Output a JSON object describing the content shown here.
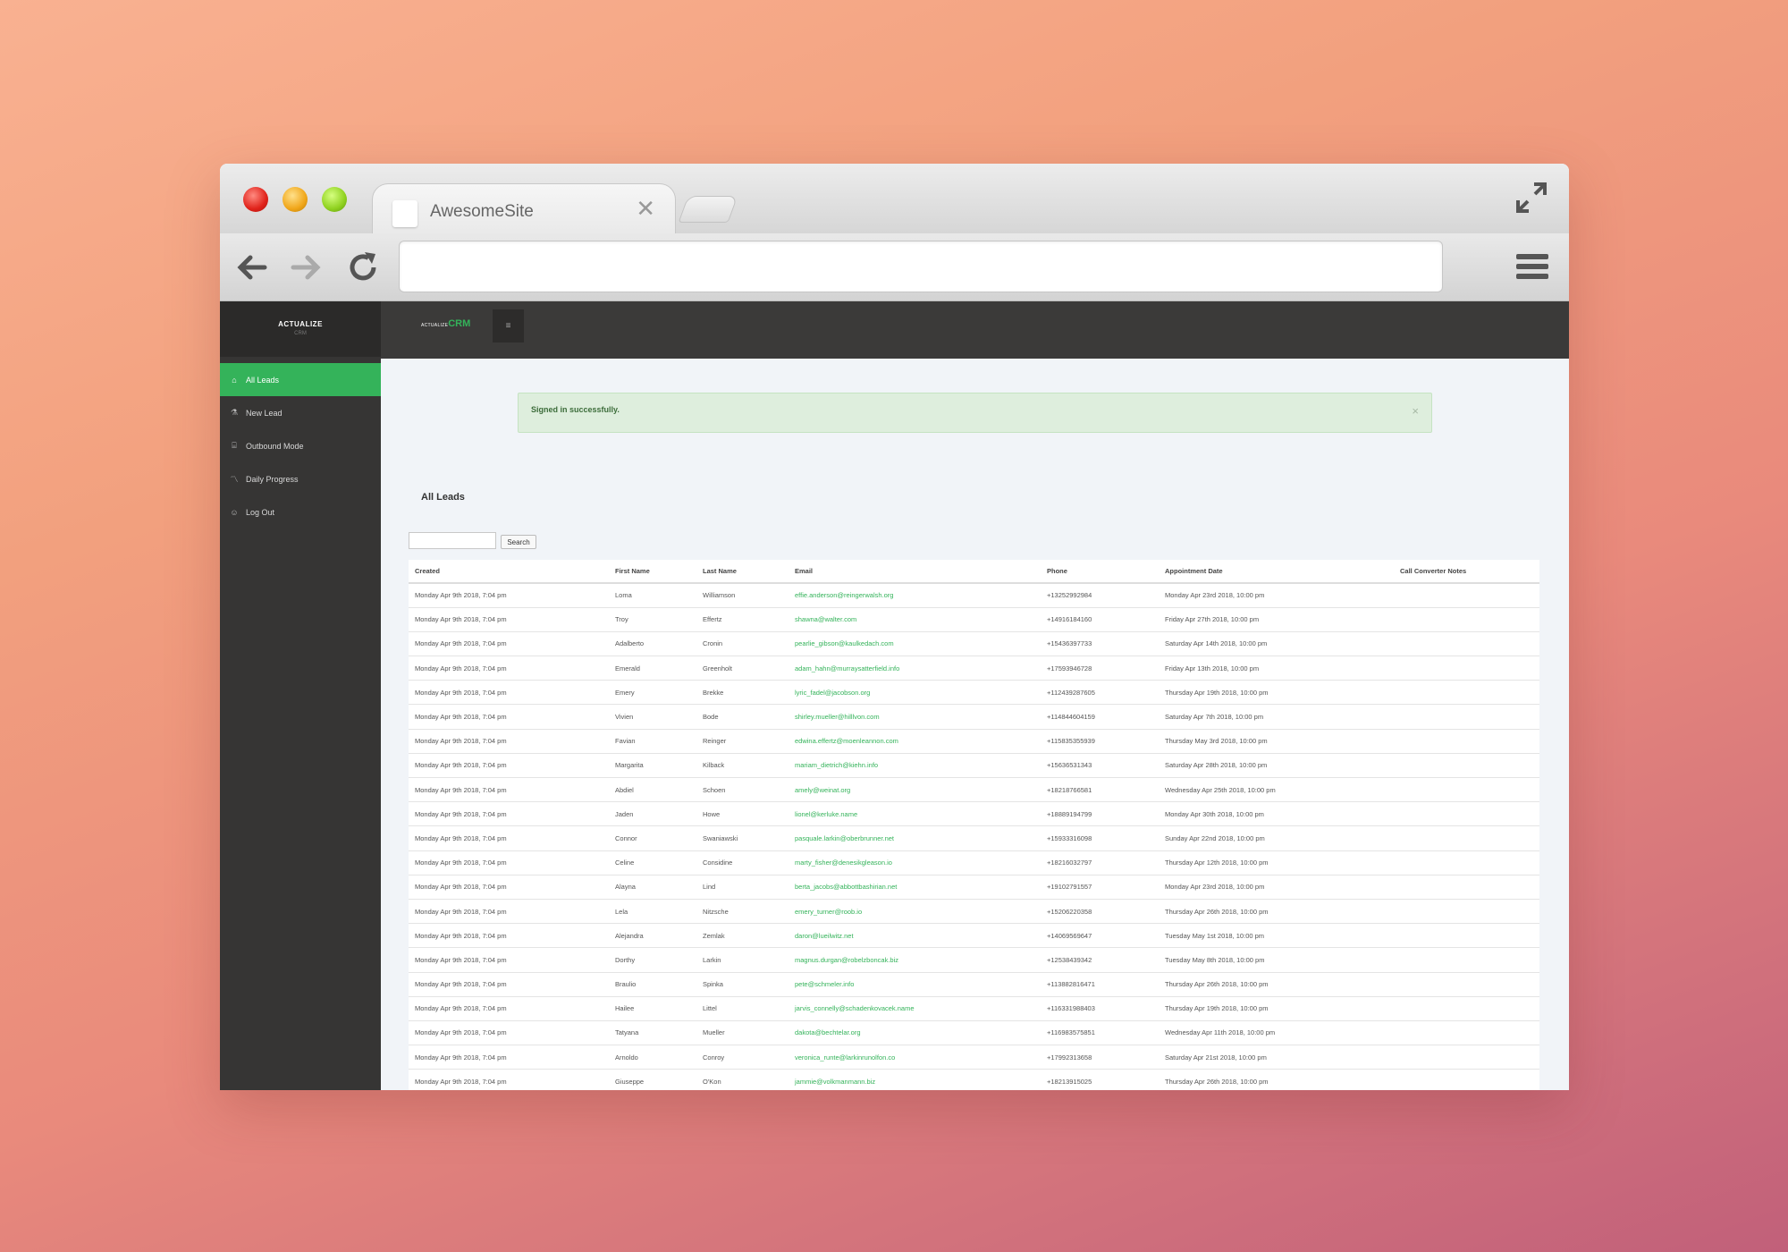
{
  "browser": {
    "tab_title": "AwesomeSite",
    "url": ""
  },
  "app": {
    "brand_name": "ACTUALIZE",
    "brand_sub": "CRM",
    "logo_small": "ACTUALIZE",
    "logo_big": "CRM",
    "hamburger_glyph": "≡"
  },
  "sidebar": {
    "items": [
      {
        "label": "All Leads",
        "icon": "home-icon"
      },
      {
        "label": "New Lead",
        "icon": "flask-icon"
      },
      {
        "label": "Outbound Mode",
        "icon": "bank-icon"
      },
      {
        "label": "Daily Progress",
        "icon": "chart-line-icon"
      },
      {
        "label": "Log Out",
        "icon": "user-icon"
      }
    ]
  },
  "alert": {
    "message": "Signed in successfully.",
    "close": "×"
  },
  "page": {
    "title": "All Leads",
    "search_value": "",
    "search_button": "Search"
  },
  "table": {
    "headers": [
      "Created",
      "First Name",
      "Last Name",
      "Email",
      "Phone",
      "Appointment Date",
      "Call Converter Notes"
    ],
    "rows": [
      [
        "Monday Apr 9th 2018, 7:04 pm",
        "Loma",
        "Williamson",
        "effie.anderson@reingerwalsh.org",
        "+13252992984",
        "Monday Apr 23rd 2018, 10:00 pm",
        ""
      ],
      [
        "Monday Apr 9th 2018, 7:04 pm",
        "Troy",
        "Effertz",
        "shawna@walter.com",
        "+14916184160",
        "Friday Apr 27th 2018, 10:00 pm",
        ""
      ],
      [
        "Monday Apr 9th 2018, 7:04 pm",
        "Adalberto",
        "Cronin",
        "pearlie_gibson@kaulkedach.com",
        "+15436397733",
        "Saturday Apr 14th 2018, 10:00 pm",
        ""
      ],
      [
        "Monday Apr 9th 2018, 7:04 pm",
        "Emerald",
        "Greenholt",
        "adam_hahn@murraysatterfield.info",
        "+17593946728",
        "Friday Apr 13th 2018, 10:00 pm",
        ""
      ],
      [
        "Monday Apr 9th 2018, 7:04 pm",
        "Emery",
        "Brekke",
        "lyric_fadel@jacobson.org",
        "+112439287605",
        "Thursday Apr 19th 2018, 10:00 pm",
        ""
      ],
      [
        "Monday Apr 9th 2018, 7:04 pm",
        "Vivien",
        "Bode",
        "shirley.mueller@hilllvon.com",
        "+114844604159",
        "Saturday Apr 7th 2018, 10:00 pm",
        ""
      ],
      [
        "Monday Apr 9th 2018, 7:04 pm",
        "Favian",
        "Reinger",
        "edwina.effertz@moenleannon.com",
        "+115835355939",
        "Thursday May 3rd 2018, 10:00 pm",
        ""
      ],
      [
        "Monday Apr 9th 2018, 7:04 pm",
        "Margarita",
        "Kilback",
        "mariam_dietrich@kiehn.info",
        "+15636531343",
        "Saturday Apr 28th 2018, 10:00 pm",
        ""
      ],
      [
        "Monday Apr 9th 2018, 7:04 pm",
        "Abdiel",
        "Schoen",
        "amely@weinat.org",
        "+18218766581",
        "Wednesday Apr 25th 2018, 10:00 pm",
        ""
      ],
      [
        "Monday Apr 9th 2018, 7:04 pm",
        "Jaden",
        "Howe",
        "lionel@kerluke.name",
        "+18889194799",
        "Monday Apr 30th 2018, 10:00 pm",
        ""
      ],
      [
        "Monday Apr 9th 2018, 7:04 pm",
        "Connor",
        "Swaniawski",
        "pasquale.larkin@oberbrunner.net",
        "+15933316098",
        "Sunday Apr 22nd 2018, 10:00 pm",
        ""
      ],
      [
        "Monday Apr 9th 2018, 7:04 pm",
        "Celine",
        "Considine",
        "marty_fisher@denesikgleason.io",
        "+18216032797",
        "Thursday Apr 12th 2018, 10:00 pm",
        ""
      ],
      [
        "Monday Apr 9th 2018, 7:04 pm",
        "Alayna",
        "Lind",
        "berta_jacobs@abbottbashirian.net",
        "+19102791557",
        "Monday Apr 23rd 2018, 10:00 pm",
        ""
      ],
      [
        "Monday Apr 9th 2018, 7:04 pm",
        "Lela",
        "Nitzsche",
        "emery_turner@roob.io",
        "+15206220358",
        "Thursday Apr 26th 2018, 10:00 pm",
        ""
      ],
      [
        "Monday Apr 9th 2018, 7:04 pm",
        "Alejandra",
        "Zemlak",
        "daron@lueilwitz.net",
        "+14069569647",
        "Tuesday May 1st 2018, 10:00 pm",
        ""
      ],
      [
        "Monday Apr 9th 2018, 7:04 pm",
        "Dorthy",
        "Larkin",
        "magnus.durgan@robelzboncak.biz",
        "+12538439342",
        "Tuesday May 8th 2018, 10:00 pm",
        ""
      ],
      [
        "Monday Apr 9th 2018, 7:04 pm",
        "Braulio",
        "Spinka",
        "pete@schmeler.info",
        "+113882816471",
        "Thursday Apr 26th 2018, 10:00 pm",
        ""
      ],
      [
        "Monday Apr 9th 2018, 7:04 pm",
        "Hailee",
        "Littel",
        "jarvis_connelly@schadenkovacek.name",
        "+116331988403",
        "Thursday Apr 19th 2018, 10:00 pm",
        ""
      ],
      [
        "Monday Apr 9th 2018, 7:04 pm",
        "Tatyana",
        "Mueller",
        "dakota@bechtelar.org",
        "+116983575851",
        "Wednesday Apr 11th 2018, 10:00 pm",
        ""
      ],
      [
        "Monday Apr 9th 2018, 7:04 pm",
        "Arnoldo",
        "Conroy",
        "veronica_runte@larkinrunolfon.co",
        "+17992313658",
        "Saturday Apr 21st 2018, 10:00 pm",
        ""
      ],
      [
        "Monday Apr 9th 2018, 7:04 pm",
        "Giuseppe",
        "O'Kon",
        "jammie@volkmanmann.biz",
        "+18213915025",
        "Thursday Apr 26th 2018, 10:00 pm",
        ""
      ]
    ]
  },
  "colors": {
    "accent": "#34b35a",
    "sidebar_bg": "#363534",
    "topnav_bg": "#3b3a39",
    "alert_bg": "#deeedd"
  }
}
